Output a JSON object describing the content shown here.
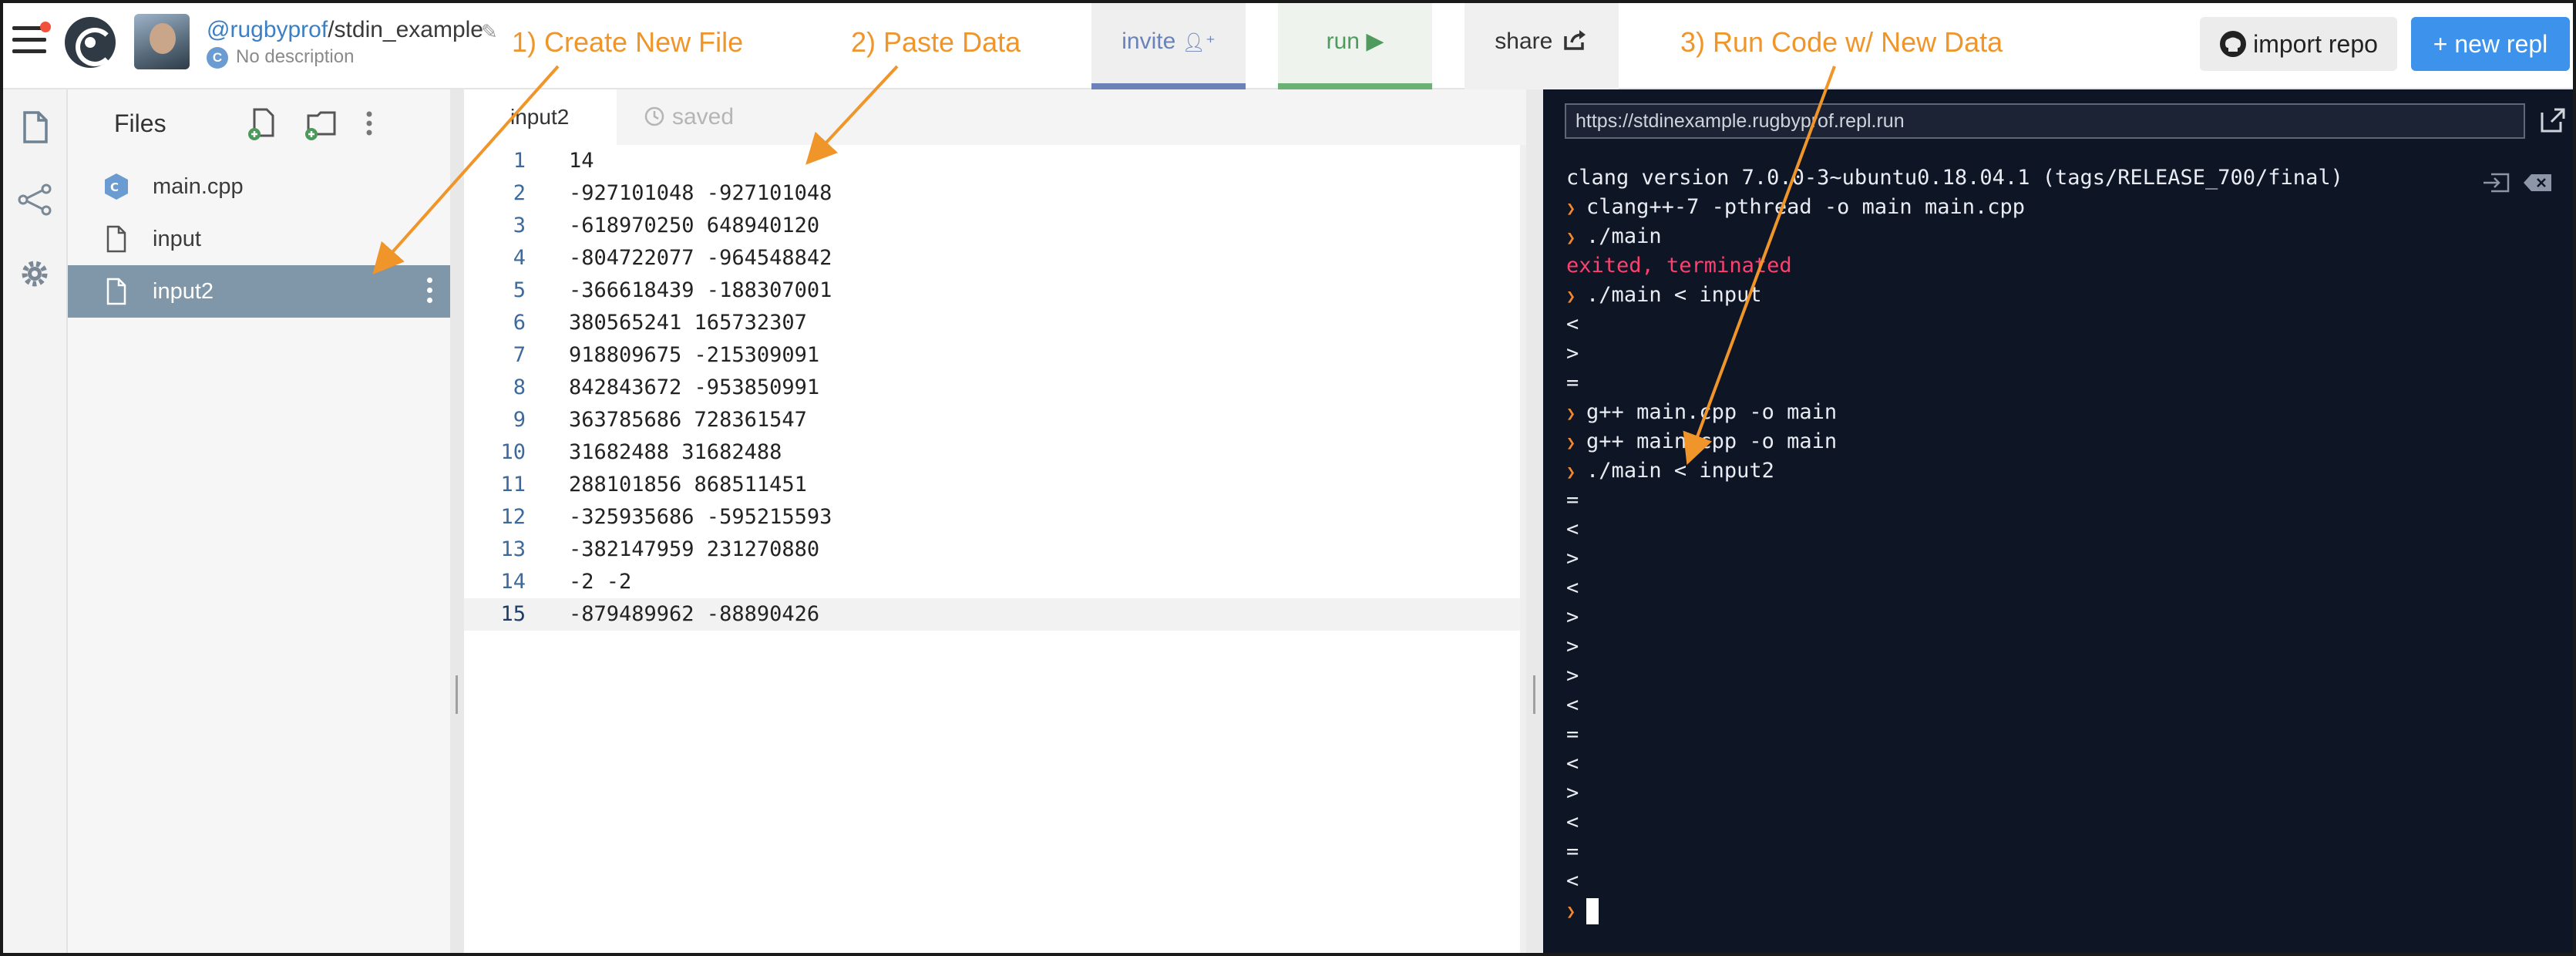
{
  "header": {
    "user": "@rugbyprof",
    "separator": "/",
    "repl_name": "stdin_example",
    "description": "No description",
    "lang_badge": "C",
    "invite_label": "invite",
    "invite_icon_glyph": "➕",
    "run_label": "run",
    "run_icon_glyph": "▶",
    "share_label": "share",
    "import_label": "import repo",
    "new_repl_label": "+ new repl"
  },
  "sidebar": {
    "title": "Files",
    "files": [
      {
        "name": "main.cpp",
        "icon": "cpp-file-icon"
      },
      {
        "name": "input",
        "icon": "file-icon"
      },
      {
        "name": "input2",
        "icon": "file-icon",
        "active": true
      }
    ]
  },
  "editor": {
    "tab": "input2",
    "status": "saved",
    "lines": [
      {
        "n": "1",
        "text": "14"
      },
      {
        "n": "2",
        "text": "-927101048 -927101048"
      },
      {
        "n": "3",
        "text": "-618970250 648940120"
      },
      {
        "n": "4",
        "text": "-804722077 -964548842"
      },
      {
        "n": "5",
        "text": "-366618439 -188307001"
      },
      {
        "n": "6",
        "text": "380565241 165732307"
      },
      {
        "n": "7",
        "text": "918809675 -215309091"
      },
      {
        "n": "8",
        "text": "842843672 -953850991"
      },
      {
        "n": "9",
        "text": "363785686 728361547"
      },
      {
        "n": "10",
        "text": "31682488 31682488"
      },
      {
        "n": "11",
        "text": "288101856 868511451"
      },
      {
        "n": "12",
        "text": "-325935686 -595215593"
      },
      {
        "n": "13",
        "text": "-382147959 231270880"
      },
      {
        "n": "14",
        "text": "-2 -2"
      },
      {
        "n": "15",
        "text": "-879489962 -88890426"
      }
    ]
  },
  "console": {
    "url": "https://stdinexample.rugbyprof.repl.run",
    "lines": [
      {
        "kind": "out",
        "text": "clang version 7.0.0-3~ubuntu0.18.04.1 (tags/RELEASE_700/final)"
      },
      {
        "kind": "cmd",
        "text": "clang++-7 -pthread -o main main.cpp"
      },
      {
        "kind": "cmd",
        "text": "./main"
      },
      {
        "kind": "err",
        "text": "exited, terminated"
      },
      {
        "kind": "cmd",
        "text": "./main < input"
      },
      {
        "kind": "out",
        "text": "<"
      },
      {
        "kind": "out",
        "text": ">"
      },
      {
        "kind": "out",
        "text": "="
      },
      {
        "kind": "cmd",
        "text": "g++ main.cpp -o main"
      },
      {
        "kind": "cmd",
        "text": "g++ main.cpp -o main"
      },
      {
        "kind": "cmd",
        "text": "./main < input2"
      },
      {
        "kind": "out",
        "text": "="
      },
      {
        "kind": "out",
        "text": "<"
      },
      {
        "kind": "out",
        "text": ">"
      },
      {
        "kind": "out",
        "text": "<"
      },
      {
        "kind": "out",
        "text": ">"
      },
      {
        "kind": "out",
        "text": ">"
      },
      {
        "kind": "out",
        "text": ">"
      },
      {
        "kind": "out",
        "text": "<"
      },
      {
        "kind": "out",
        "text": "="
      },
      {
        "kind": "out",
        "text": "<"
      },
      {
        "kind": "out",
        "text": ">"
      },
      {
        "kind": "out",
        "text": "<"
      },
      {
        "kind": "out",
        "text": "="
      },
      {
        "kind": "out",
        "text": "<"
      },
      {
        "kind": "cursor",
        "text": ""
      }
    ]
  },
  "annotations": {
    "step1": "1) Create New File",
    "step2": "2) Paste Data",
    "step3": "3) Run Code w/ New Data"
  },
  "colors": {
    "annotation": "#f0952a",
    "console_bg": "#0e1525",
    "error_text": "#ff3f6e",
    "active_file_bg": "#7f97a8",
    "new_repl_bg": "#3d92ec",
    "run_accent": "#6ab274",
    "invite_accent": "#6a82b8"
  }
}
